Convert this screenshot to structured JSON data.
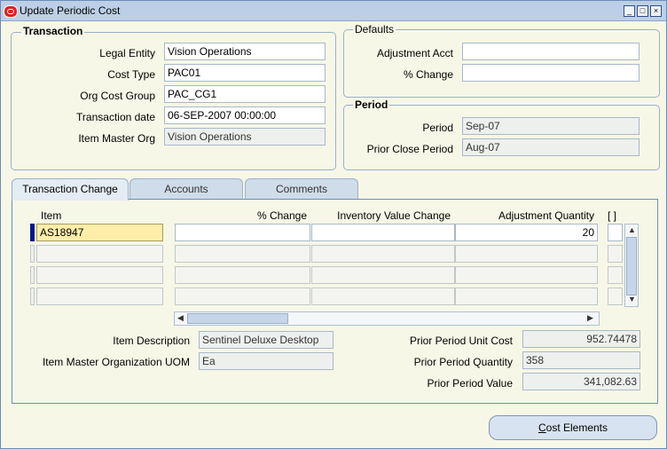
{
  "window": {
    "title": "Update Periodic Cost"
  },
  "transaction": {
    "title": "Transaction",
    "legal_entity_label": "Legal Entity",
    "legal_entity": "Vision Operations",
    "cost_type_label": "Cost Type",
    "cost_type": "PAC01",
    "org_cost_group_label": "Org Cost Group",
    "org_cost_group": "PAC_CG1",
    "transaction_date_label": "Transaction date",
    "transaction_date": "06-SEP-2007 00:00:00",
    "item_master_org_label": "Item Master Org",
    "item_master_org": "Vision Operations"
  },
  "defaults": {
    "title": "Defaults",
    "adjustment_acct_label": "Adjustment Acct",
    "adjustment_acct": "",
    "pct_change_label": "% Change",
    "pct_change": ""
  },
  "period": {
    "title": "Period",
    "period_label": "Period",
    "period": "Sep-07",
    "prior_close_label": "Prior Close Period",
    "prior_close": "Aug-07"
  },
  "tabs": [
    {
      "label": "Transaction Change",
      "active": true
    },
    {
      "label": "Accounts",
      "active": false
    },
    {
      "label": "Comments",
      "active": false
    }
  ],
  "grid": {
    "headers": {
      "item": "Item",
      "pct_change": "% Change",
      "inv_value_change": "Inventory Value Change",
      "adj_qty": "Adjustment Quantity",
      "flex": "[ ]"
    },
    "rows": [
      {
        "item": "AS18947",
        "pct_change": "",
        "inv_value_change": "",
        "adj_qty": "20"
      }
    ]
  },
  "details": {
    "item_desc_label": "Item Description",
    "item_desc": "Sentinel Deluxe Desktop",
    "uom_label": "Item Master Organization UOM",
    "uom": "Ea",
    "unit_cost_label": "Prior Period Unit Cost",
    "unit_cost": "952.74478",
    "qty_label": "Prior Period Quantity",
    "qty": "358",
    "value_label": "Prior Period Value",
    "value": "341,082.63"
  },
  "buttons": {
    "cost_elements": "ost Elements",
    "cost_elements_mnemonic": "C"
  }
}
